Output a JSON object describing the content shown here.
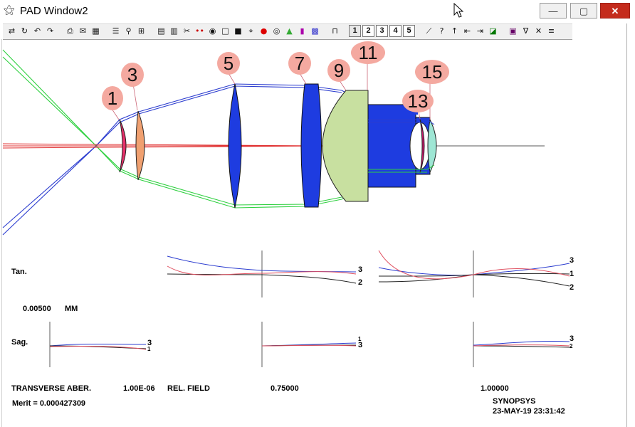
{
  "window": {
    "title": "PAD Window2",
    "app_icon": "pad-icon",
    "controls": {
      "minimize": "—",
      "maximize": "▢",
      "close": "✕"
    }
  },
  "toolbar": {
    "icons": [
      "swap-icon",
      "rotate-icon",
      "undo-icon",
      "redo-icon",
      "print-icon",
      "scan-icon",
      "grid-icon",
      "list-icon",
      "lens-icon",
      "calc-icon",
      "table-icon",
      "table2-icon",
      "cut-icon",
      "dots-icon",
      "ring-icon",
      "square-icon",
      "filled-square-icon",
      "target-icon",
      "red-circle-icon",
      "eye-icon",
      "bars-color-icon",
      "stripes-icon",
      "hatch-icon",
      "ruler-icon"
    ],
    "numbers": [
      "1",
      "2",
      "3",
      "4",
      "5"
    ],
    "icons_right": [
      "line-icon",
      "help-icon",
      "up-arrow-icon",
      "left-bar-icon",
      "right-bar-icon",
      "draw-icon",
      "film-icon",
      "filter-icon",
      "close-x-icon",
      "menu-icon"
    ]
  },
  "callouts": [
    "1",
    "3",
    "5",
    "7",
    "9",
    "11",
    "13",
    "15"
  ],
  "aberrations": {
    "tan_label": "Tan.",
    "sag_label": "Sag.",
    "scale_value": "0.00500",
    "scale_unit": "MM",
    "footer_label": "TRANSVERSE ABER.",
    "footer_value": "1.00E-06",
    "rel_field_label": "REL. FIELD",
    "field_1": "0.75000",
    "field_2": "1.00000",
    "merit": "Merit = 0.000427309",
    "tan_mid_labels": [
      "3",
      "2"
    ],
    "tan_right_labels": [
      "3",
      "1",
      "2"
    ],
    "sag_left_labels": [
      "3",
      "1"
    ],
    "sag_mid_labels": [
      "1",
      "3"
    ],
    "sag_right_labels": [
      "3",
      "2"
    ]
  },
  "branding": {
    "company": "SYNOPSYS",
    "timestamp": "23-MAY-19  23:31:42"
  },
  "colors": {
    "accent_red": "#e03030",
    "lens_red": "#e8306a",
    "lens_orange": "#f0a070",
    "lens_blue": "#1e3ce0",
    "lens_green": "#c8e0a0",
    "ray_blue": "#2b3ccf",
    "ray_green": "#2fd040",
    "callout_fill": "#f4a9a0"
  }
}
